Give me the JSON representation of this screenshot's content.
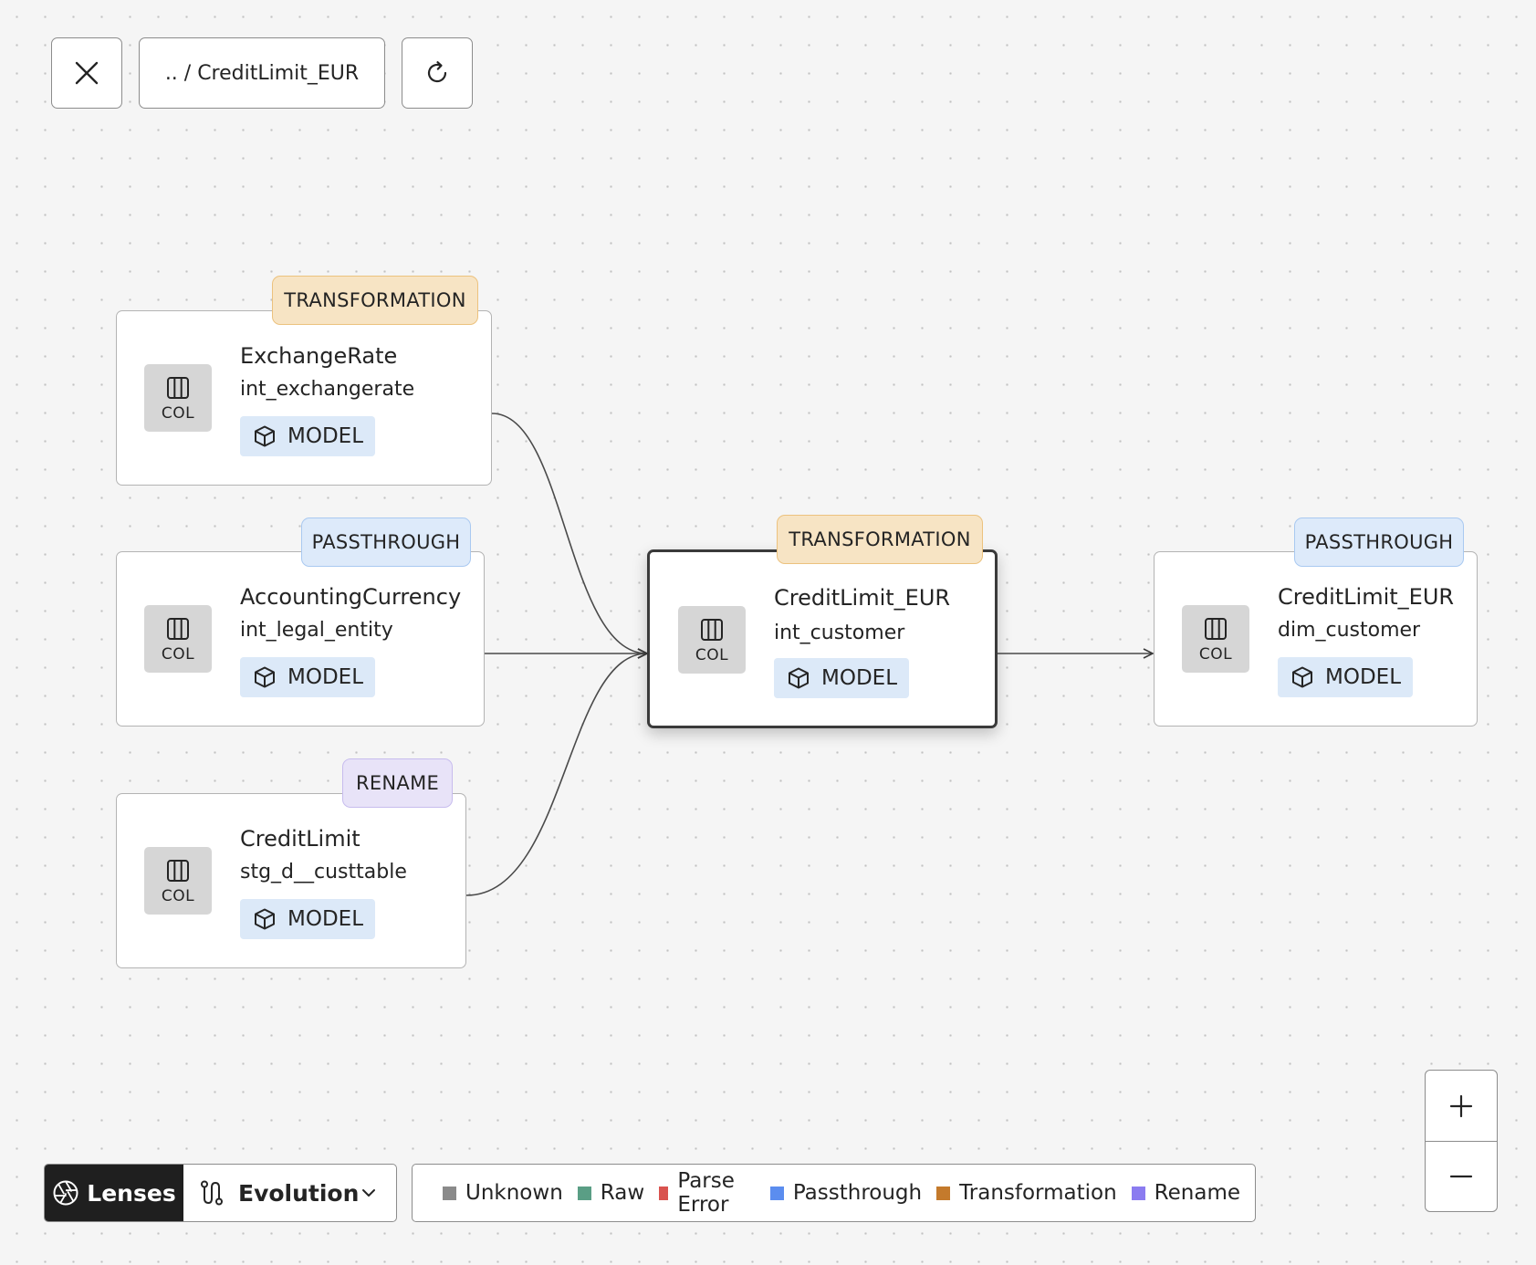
{
  "toolbar": {
    "close_icon": "close-icon",
    "breadcrumb": ".. / CreditLimit_EUR",
    "refresh_icon": "refresh-icon"
  },
  "nodes": [
    {
      "id": "exchangerate",
      "badge": "TRANSFORMATION",
      "badge_type": "transformation",
      "type_label": "COL",
      "title": "ExchangeRate",
      "subtitle": "int_exchangerate",
      "tag": "MODEL"
    },
    {
      "id": "accountingcurrency",
      "badge": "PASSTHROUGH",
      "badge_type": "passthrough",
      "type_label": "COL",
      "title": "AccountingCurrency",
      "subtitle": "int_legal_entity",
      "tag": "MODEL"
    },
    {
      "id": "creditlimit",
      "badge": "RENAME",
      "badge_type": "rename",
      "type_label": "COL",
      "title": "CreditLimit",
      "subtitle": "stg_d__custtable",
      "tag": "MODEL"
    },
    {
      "id": "creditlimit-eur-int",
      "badge": "TRANSFORMATION",
      "badge_type": "transformation",
      "type_label": "COL",
      "title": "CreditLimit_EUR",
      "subtitle": "int_customer",
      "tag": "MODEL",
      "selected": true
    },
    {
      "id": "creditlimit-eur-dim",
      "badge": "PASSTHROUGH",
      "badge_type": "passthrough",
      "type_label": "COL",
      "title": "CreditLimit_EUR",
      "subtitle": "dim_customer",
      "tag": "MODEL"
    }
  ],
  "bottom": {
    "lenses_label": "Lenses",
    "evolution_label": "Evolution"
  },
  "legend": [
    {
      "label": "Unknown",
      "color": "#8a8a8a"
    },
    {
      "label": "Raw",
      "color": "#5a9e85"
    },
    {
      "label": "Parse Error",
      "color": "#d9534f"
    },
    {
      "label": "Passthrough",
      "color": "#5b8def"
    },
    {
      "label": "Transformation",
      "color": "#c47a2c"
    },
    {
      "label": "Rename",
      "color": "#8b7cf0"
    }
  ],
  "zoom": {
    "in_icon": "plus-icon",
    "out_icon": "minus-icon"
  }
}
